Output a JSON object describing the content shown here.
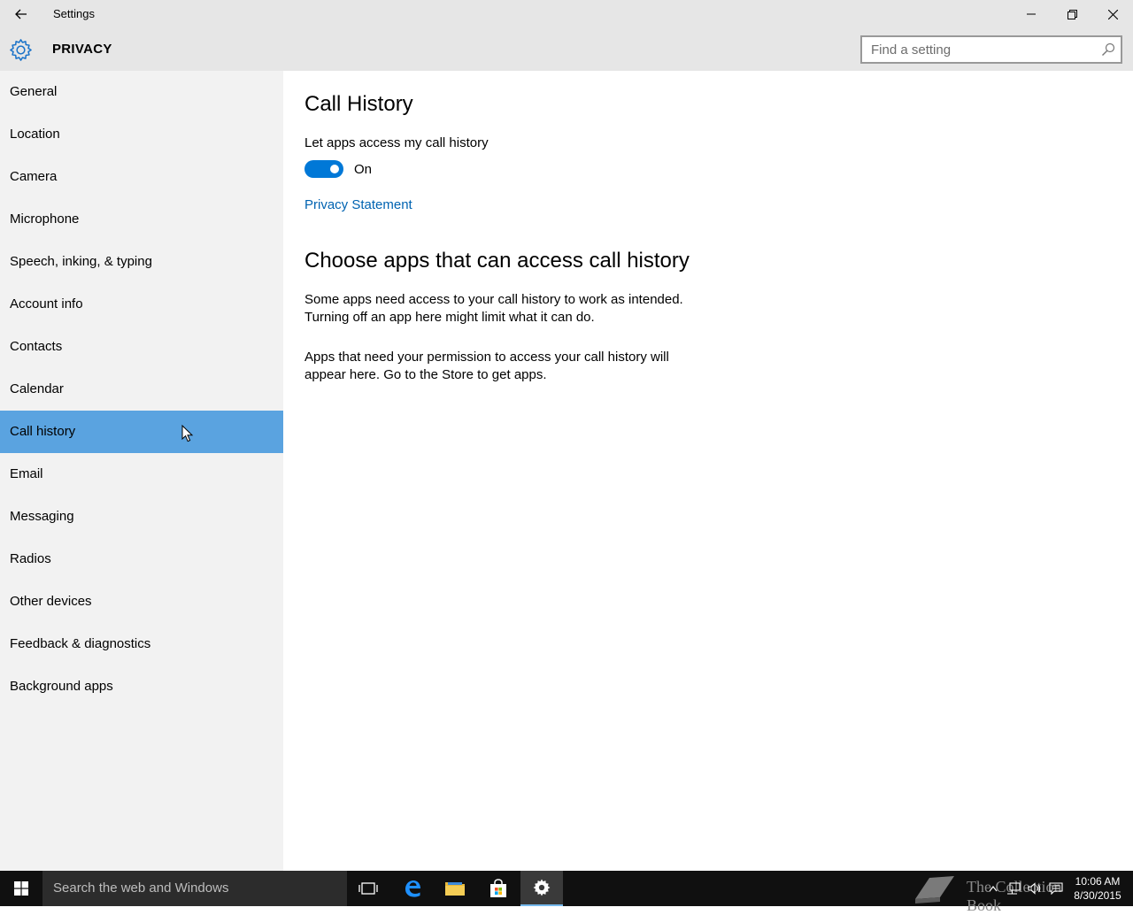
{
  "window": {
    "title": "Settings"
  },
  "header": {
    "section_title": "PRIVACY",
    "search_placeholder": "Find a setting"
  },
  "sidebar": {
    "items": [
      {
        "label": "General"
      },
      {
        "label": "Location"
      },
      {
        "label": "Camera"
      },
      {
        "label": "Microphone"
      },
      {
        "label": "Speech, inking, & typing"
      },
      {
        "label": "Account info"
      },
      {
        "label": "Contacts"
      },
      {
        "label": "Calendar"
      },
      {
        "label": "Call history",
        "active": true
      },
      {
        "label": "Email"
      },
      {
        "label": "Messaging"
      },
      {
        "label": "Radios"
      },
      {
        "label": "Other devices"
      },
      {
        "label": "Feedback & diagnostics"
      },
      {
        "label": "Background apps"
      }
    ]
  },
  "main": {
    "heading": "Call History",
    "toggle_label": "Let apps access my call history",
    "toggle_state": "On",
    "toggle_on": true,
    "privacy_link": "Privacy Statement",
    "subheading": "Choose apps that can access call history",
    "para1_line1": "Some apps need access to your call history to work as intended.",
    "para1_line2": "Turning off an app here might limit what it can do.",
    "para2_line1": "Apps that need your permission to access your call history will",
    "para2_line2": "appear here. Go to the Store to get apps."
  },
  "taskbar": {
    "search_text": "Search the web and Windows",
    "watermark": "The Collection Book",
    "time": "10:06 AM",
    "date": "8/30/2015"
  },
  "colors": {
    "accent": "#0078d7",
    "selected_nav": "#5aa3e0",
    "link": "#0063b1"
  }
}
